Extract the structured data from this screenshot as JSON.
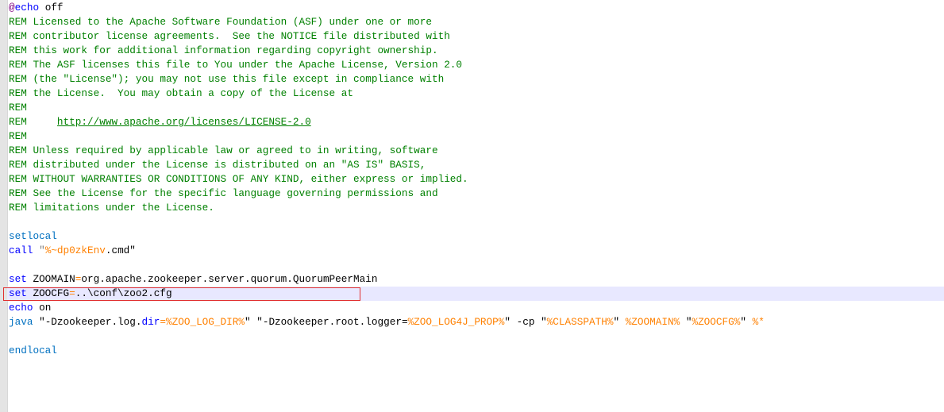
{
  "editor": {
    "lines": [
      [
        {
          "t": "@",
          "c": "at"
        },
        {
          "t": "echo",
          "c": "kw"
        },
        {
          "t": " off",
          "c": "plain"
        }
      ],
      [
        {
          "t": "REM Licensed to the Apache Software Foundation (ASF) under one or more",
          "c": "rem"
        }
      ],
      [
        {
          "t": "REM contributor license agreements.  See the NOTICE file distributed with",
          "c": "rem"
        }
      ],
      [
        {
          "t": "REM this work for additional information regarding copyright ownership.",
          "c": "rem"
        }
      ],
      [
        {
          "t": "REM The ASF licenses this file to You under the Apache License, Version 2.0",
          "c": "rem"
        }
      ],
      [
        {
          "t": "REM (the \"License\"); you may not use this file except in compliance with",
          "c": "rem"
        }
      ],
      [
        {
          "t": "REM the License.  You may obtain a copy of the License at",
          "c": "rem"
        }
      ],
      [
        {
          "t": "REM",
          "c": "rem"
        }
      ],
      [
        {
          "t": "REM     ",
          "c": "rem"
        },
        {
          "t": "http://www.apache.org/licenses/LICENSE-2.0",
          "c": "url"
        }
      ],
      [
        {
          "t": "REM",
          "c": "rem"
        }
      ],
      [
        {
          "t": "REM Unless required by applicable law or agreed to in writing, software",
          "c": "rem"
        }
      ],
      [
        {
          "t": "REM distributed under the License is distributed on an \"AS IS\" BASIS,",
          "c": "rem"
        }
      ],
      [
        {
          "t": "REM WITHOUT WARRANTIES OR CONDITIONS OF ANY KIND, either express or implied.",
          "c": "rem"
        }
      ],
      [
        {
          "t": "REM See the License for the specific language governing permissions and",
          "c": "rem"
        }
      ],
      [
        {
          "t": "REM limitations under the License.",
          "c": "rem"
        }
      ],
      [],
      [
        {
          "t": "setlocal",
          "c": "cmd"
        }
      ],
      [
        {
          "t": "call",
          "c": "kw"
        },
        {
          "t": " \"",
          "c": "str"
        },
        {
          "t": "%~dp0zkEnv",
          "c": "var"
        },
        {
          "t": ".cmd\"",
          "c": "plain"
        }
      ],
      [],
      [
        {
          "t": "set",
          "c": "kw"
        },
        {
          "t": " ZOOMAIN",
          "c": "plain"
        },
        {
          "t": "=",
          "c": "var"
        },
        {
          "t": "org.apache.zookeeper.server.quorum.QuorumPeerMain",
          "c": "plain"
        }
      ],
      [
        {
          "t": "set",
          "c": "kw"
        },
        {
          "t": " ZOOCFG",
          "c": "plain"
        },
        {
          "t": "=",
          "c": "var"
        },
        {
          "t": "..\\conf\\zoo2.cfg",
          "c": "plain"
        }
      ],
      [
        {
          "t": "echo",
          "c": "kw"
        },
        {
          "t": " on",
          "c": "plain"
        }
      ],
      [
        {
          "t": "java",
          "c": "cmd"
        },
        {
          "t": " \"-Dzookeeper.log.",
          "c": "plain"
        },
        {
          "t": "dir",
          "c": "kw"
        },
        {
          "t": "=",
          "c": "var"
        },
        {
          "t": "%ZOO_LOG_DIR%",
          "c": "var"
        },
        {
          "t": "\" \"-Dzookeeper.root.logger=",
          "c": "plain"
        },
        {
          "t": "%ZOO_LOG4J_PROP%",
          "c": "var"
        },
        {
          "t": "\" -cp \"",
          "c": "plain"
        },
        {
          "t": "%CLASSPATH%",
          "c": "var"
        },
        {
          "t": "\" ",
          "c": "plain"
        },
        {
          "t": "%ZOOMAIN%",
          "c": "var"
        },
        {
          "t": " \"",
          "c": "plain"
        },
        {
          "t": "%ZOOCFG%",
          "c": "var"
        },
        {
          "t": "\" ",
          "c": "plain"
        },
        {
          "t": "%*",
          "c": "var"
        }
      ],
      [],
      [
        {
          "t": "endlocal",
          "c": "cmd"
        }
      ]
    ],
    "current_line_index": 20,
    "highlighted_line_index": 20
  }
}
